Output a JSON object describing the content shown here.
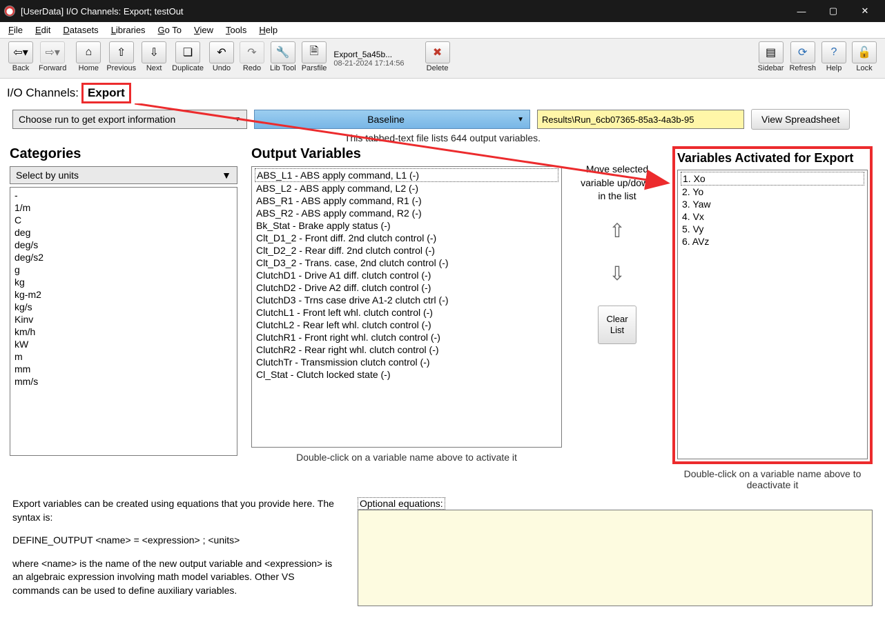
{
  "title": "[UserData] I/O Channels: Export; testOut",
  "menu": [
    "File",
    "Edit",
    "Datasets",
    "Libraries",
    "Go To",
    "View",
    "Tools",
    "Help"
  ],
  "toolbar": {
    "back": "Back",
    "forward": "Forward",
    "home": "Home",
    "previous": "Previous",
    "next": "Next",
    "duplicate": "Duplicate",
    "undo": "Undo",
    "redo": "Redo",
    "libtool": "Lib Tool",
    "parsfile": "Parsfile",
    "delete": "Delete",
    "file_name": "Export_5a45b...",
    "file_date": "08-21-2024 17:14:56",
    "sidebar": "Sidebar",
    "refresh": "Refresh",
    "help": "Help",
    "lock": "Lock"
  },
  "ioc": {
    "label": "I/O Channels:",
    "export": "Export"
  },
  "choose": {
    "run_label": "Choose run to get export information",
    "baseline": "Baseline",
    "path": "Results\\Run_6cb07365-85a3-4a3b-95",
    "view_btn": "View Spreadsheet",
    "tabbed": "This tabbed-text file lists 644 output variables."
  },
  "categories": {
    "title": "Categories",
    "select_units": "Select by units",
    "items": [
      "-",
      "1/m",
      "C",
      "deg",
      "deg/s",
      "deg/s2",
      "g",
      "kg",
      "kg-m2",
      "kg/s",
      "Kinv",
      "km/h",
      "kW",
      "m",
      "mm",
      "mm/s"
    ]
  },
  "output": {
    "title": "Output Variables",
    "items": [
      "ABS_L1 - ABS apply command, L1 (-)",
      "ABS_L2 - ABS apply command, L2 (-)",
      "ABS_R1 - ABS apply command, R1 (-)",
      "ABS_R2 - ABS apply command, R2 (-)",
      "Bk_Stat - Brake apply status (-)",
      "Clt_D1_2 - Front diff. 2nd clutch control (-)",
      "Clt_D2_2 - Rear diff. 2nd clutch control (-)",
      "Clt_D3_2 - Trans. case, 2nd clutch control (-)",
      "ClutchD1 - Drive A1 diff. clutch control (-)",
      "ClutchD2 - Drive A2 diff. clutch control (-)",
      "ClutchD3 - Trns case drive A1-2 clutch ctrl (-)",
      "ClutchL1 - Front left whl. clutch control (-)",
      "ClutchL2 - Rear left whl. clutch control (-)",
      "ClutchR1 - Front right whl. clutch control (-)",
      "ClutchR2 - Rear right whl. clutch control (-)",
      "ClutchTr - Transmission clutch control (-)",
      "Cl_Stat - Clutch locked state (-)"
    ],
    "hint": "Double-click on a variable name above to activate it"
  },
  "move": {
    "desc": "Move selected variable up/down in the list",
    "clear": "Clear List"
  },
  "activated": {
    "title": "Variables Activated for Export",
    "items": [
      "1. Xo",
      "2. Yo",
      "3. Yaw",
      "4. Vx",
      "5. Vy",
      "6. AVz"
    ],
    "hint": "Double-click on a variable name above to deactivate it"
  },
  "explain": {
    "p1": "Export variables can be created using equations that you provide here. The syntax is:",
    "p2": "DEFINE_OUTPUT <name> = <expression> ; <units>",
    "p3": "where <name> is the name of the new output variable and <expression> is an algebraic expression involving math model variables. Other VS commands can be used to define auxiliary variables.",
    "eq_label": "Optional equations:"
  }
}
